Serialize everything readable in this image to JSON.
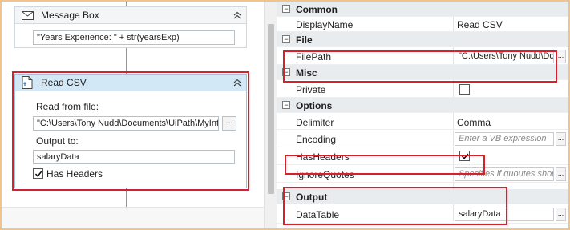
{
  "designer": {
    "message_box": {
      "title": "Message Box",
      "text_value": "\"Years Experience: \" + str(yearsExp)"
    },
    "read_csv": {
      "title": "Read CSV",
      "read_label": "Read from file:",
      "file_value": "\"C:\\Users\\Tony Nudd\\Documents\\UiPath\\MyIntelli",
      "browse_label": "...",
      "output_label": "Output to:",
      "output_value": "salaryData",
      "has_headers_label": "Has Headers",
      "has_headers_checked": true
    }
  },
  "properties": {
    "categories": {
      "common": "Common",
      "file": "File",
      "misc": "Misc",
      "options": "Options",
      "output": "Output"
    },
    "display_name": {
      "label": "DisplayName",
      "value": "Read CSV"
    },
    "file_path": {
      "label": "FilePath",
      "value": "\"C:\\Users\\Tony Nudd\\Do"
    },
    "private": {
      "label": "Private",
      "checked": false
    },
    "delimiter": {
      "label": "Delimiter",
      "value": "Comma"
    },
    "encoding": {
      "label": "Encoding",
      "placeholder": "Enter a VB expression"
    },
    "has_headers": {
      "label": "HasHeaders",
      "checked": true
    },
    "ignore_quotes": {
      "label": "IgnoreQuotes",
      "placeholder": "Specifies if quoutes should"
    },
    "data_table": {
      "label": "DataTable",
      "value": "salaryData"
    },
    "browse_label": "...",
    "toggle_symbol": "⊟"
  },
  "colors": {
    "highlight": "#d6202b",
    "selected_header": "#d3e8f7",
    "outer_border": "#f1c48e"
  }
}
